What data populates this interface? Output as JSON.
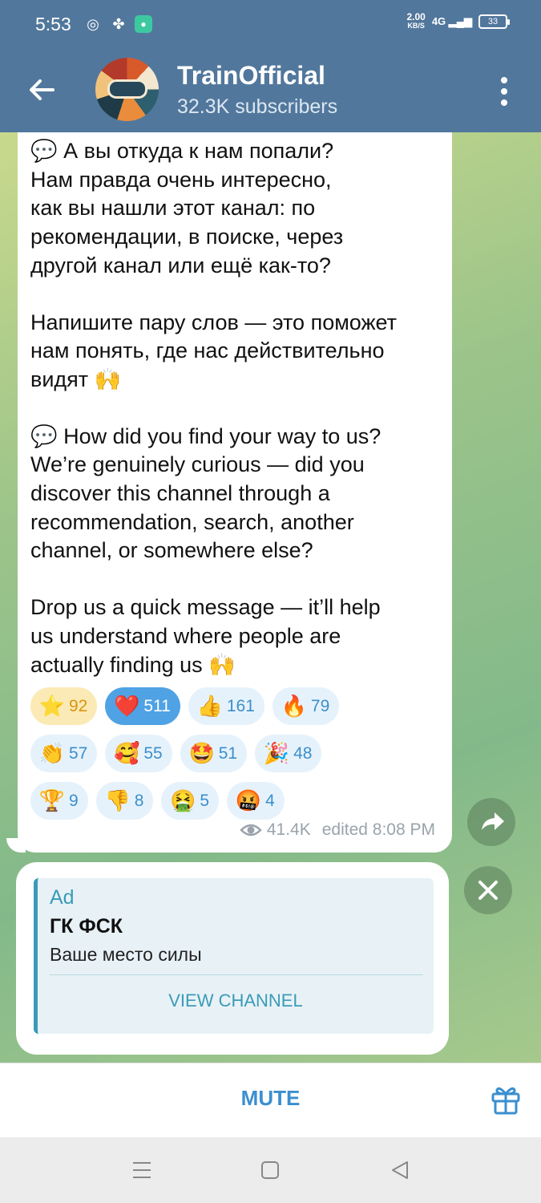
{
  "status_bar": {
    "time": "5:53",
    "net_speed_value": "2.00",
    "net_speed_unit": "KB/S",
    "signal": "4G",
    "battery": "33",
    "icons": [
      "chrome-icon",
      "fan-icon",
      "app-icon"
    ]
  },
  "header": {
    "title": "TrainOfficial",
    "subtitle": "32.3K subscribers",
    "back_icon": "arrow-left-icon",
    "more_icon": "kebab-menu-icon"
  },
  "message": {
    "paragraphs": [
      "💬 А вы откуда к нам попали?",
      "Нам правда очень интересно,",
      "как вы нашли этот канал: по",
      "рекомендации, в поиске, через",
      "другой канал или ещё как-то?",
      "",
      "Напишите пару слов — это поможет",
      "нам понять, где нас действительно",
      "видят 🙌",
      "",
      "💬 How did you find your way to us?",
      "We’re genuinely curious — did you",
      "discover this channel through a",
      "recommendation, search, another",
      "channel, or somewhere else?",
      "",
      "Drop us a quick message — it’ll help",
      "us understand where people are",
      "actually finding us 🙌"
    ],
    "reactions": [
      {
        "emoji": "⭐",
        "count": "92"
      },
      {
        "emoji": "❤️",
        "count": "511"
      },
      {
        "emoji": "👍",
        "count": "161"
      },
      {
        "emoji": "🔥",
        "count": "79"
      },
      {
        "emoji": "👏",
        "count": "57"
      },
      {
        "emoji": "🥰",
        "count": "55"
      },
      {
        "emoji": "🤩",
        "count": "51"
      },
      {
        "emoji": "🎉",
        "count": "48"
      },
      {
        "emoji": "🏆",
        "count": "9"
      },
      {
        "emoji": "👎",
        "count": "8"
      },
      {
        "emoji": "🤮",
        "count": "5"
      },
      {
        "emoji": "🤬",
        "count": "4"
      }
    ],
    "views": "41.4K",
    "edited": "edited 8:08 PM"
  },
  "ad": {
    "label": "Ad",
    "name": "ГК ФСК",
    "description": "Ваше место силы",
    "button": "VIEW CHANNEL"
  },
  "bottom_bar": {
    "mute_label": "MUTE"
  },
  "colors": {
    "header_bg": "#52779c",
    "accent": "#3a8fd0",
    "ad_accent": "#3a9bb8",
    "star_reaction_bg": "#fbeab6",
    "selected_reaction_bg": "#4fa2e4"
  }
}
